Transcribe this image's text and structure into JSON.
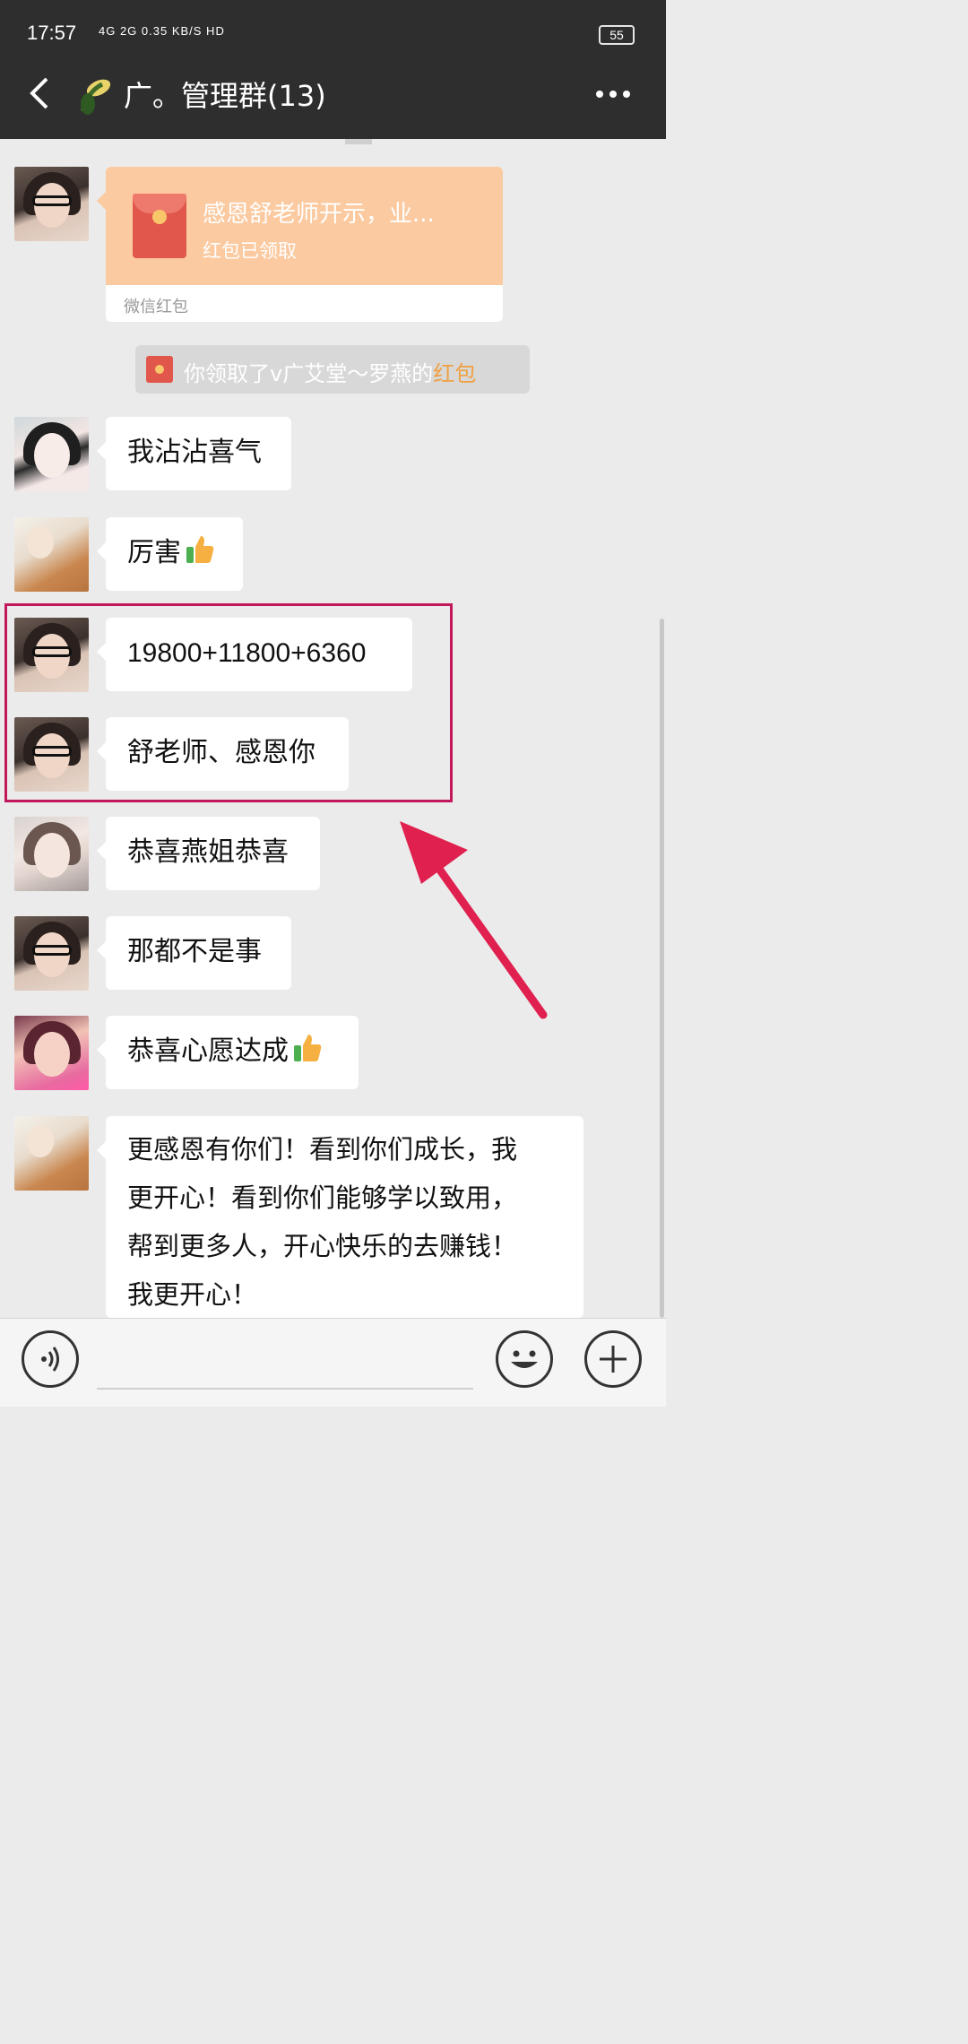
{
  "status": {
    "time": "17:57",
    "network": "4G 2G 0.35 KB/S HD",
    "battery": "55"
  },
  "header": {
    "title": "广。管理群(13)"
  },
  "red_packet": {
    "title": "感恩舒老师开示，业...",
    "status": "红包已领取",
    "footer": "微信红包"
  },
  "notice": {
    "prefix": "你领取了v广艾堂～罗燕的",
    "link": "红包"
  },
  "messages": [
    {
      "text": "我沾沾喜气"
    },
    {
      "text": "厉害"
    },
    {
      "text": "19800+11800+6360"
    },
    {
      "text": "舒老师、感恩你"
    },
    {
      "text": "恭喜燕姐恭喜"
    },
    {
      "text": "那都不是事"
    },
    {
      "text": "恭喜心愿达成"
    },
    {
      "lines": [
        "更感恩有你们！看到你们成长，我",
        "更开心！看到你们能够学以致用，",
        "帮到更多人，开心快乐的去赚钱！",
        "我更开心！"
      ]
    }
  ],
  "colors": {
    "header_bg": "#2e2e2e",
    "highlight": "#c2185b",
    "packet": "#fbcaa0"
  }
}
